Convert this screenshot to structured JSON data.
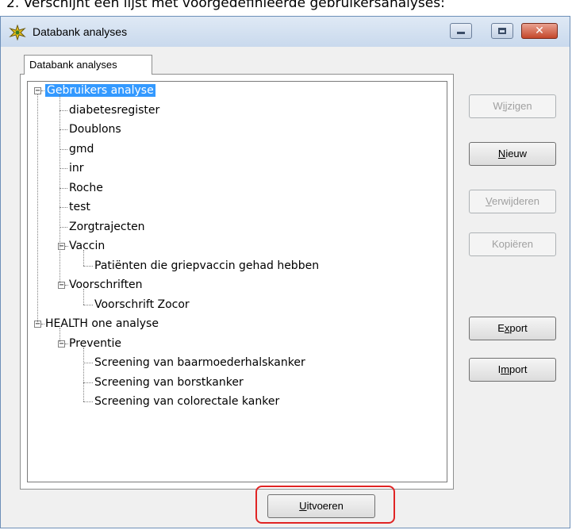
{
  "caption": "2. Verschijnt een lijst met voorgedefinieerde gebruikersanalyses:",
  "window": {
    "title": "Databank analyses",
    "tab_label": "Databank analyses"
  },
  "tree": [
    {
      "label": "Gebruikers analyse",
      "level": 0,
      "expander": "−",
      "selected": true
    },
    {
      "label": "diabetesregister",
      "level": 1
    },
    {
      "label": "Doublons",
      "level": 1
    },
    {
      "label": "gmd",
      "level": 1
    },
    {
      "label": "inr",
      "level": 1
    },
    {
      "label": "Roche",
      "level": 1
    },
    {
      "label": "test",
      "level": 1
    },
    {
      "label": "Zorgtrajecten",
      "level": 1
    },
    {
      "label": "Vaccin",
      "level": 1,
      "expander": "−"
    },
    {
      "label": "Patiënten die griepvaccin gehad hebben",
      "level": 2
    },
    {
      "label": "Voorschriften",
      "level": 1,
      "expander": "−"
    },
    {
      "label": "Voorschrift Zocor",
      "level": 2
    },
    {
      "label": "HEALTH one analyse",
      "level": 0,
      "expander": "−"
    },
    {
      "label": "Preventie",
      "level": 1,
      "expander": "−"
    },
    {
      "label": "Screening van baarmoederhalskanker",
      "level": 2
    },
    {
      "label": "Screening van borstkanker",
      "level": 2
    },
    {
      "label": "Screening van colorectale kanker",
      "level": 2
    }
  ],
  "buttons": {
    "wijzigen": {
      "pre": "W",
      "key": "i",
      "post": "jzigen",
      "enabled": false
    },
    "nieuw": {
      "pre": "",
      "key": "N",
      "post": "ieuw",
      "enabled": true
    },
    "verwijderen": {
      "pre": "",
      "key": "V",
      "post": "erwijderen",
      "enabled": false
    },
    "kopieren": {
      "pre": "Kopiëren",
      "key": "",
      "post": "",
      "enabled": false
    },
    "export": {
      "pre": "E",
      "key": "x",
      "post": "port",
      "enabled": true
    },
    "import": {
      "pre": "I",
      "key": "m",
      "post": "port",
      "enabled": true
    },
    "uitvoeren": {
      "pre": "",
      "key": "U",
      "post": "itvoeren",
      "enabled": true
    }
  },
  "colors": {
    "selection": "#3399ff",
    "highlight": "#e02424"
  }
}
